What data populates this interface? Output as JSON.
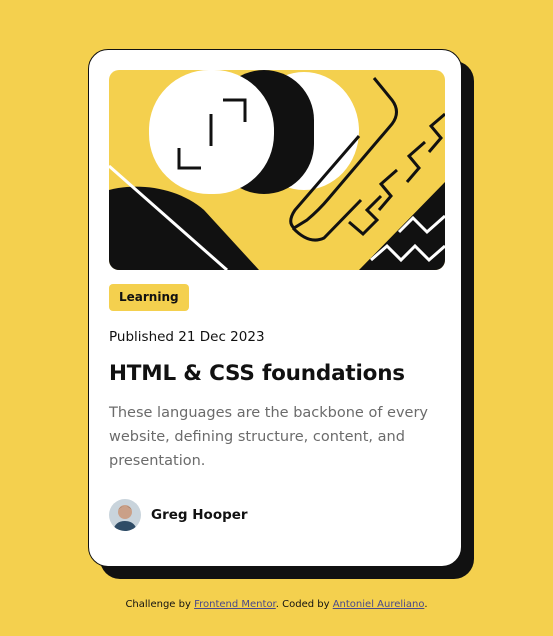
{
  "card": {
    "tag_label": "Learning",
    "published": "Published 21 Dec 2023",
    "title": "HTML & CSS foundations",
    "description": "These languages are the backbone of every website, defining structure, content, and presentation.",
    "author_name": "Greg Hooper"
  },
  "attribution": {
    "prefix": "Challenge by",
    "link1_text": "Frontend Mentor",
    "middle": ". Coded by",
    "link2_text": "Antoniel Aureliano",
    "suffix": "."
  },
  "colors": {
    "background": "#F4D04E",
    "card": "#FFFFFF",
    "ink": "#111111",
    "muted_text": "#6B6B6B"
  },
  "icons": {
    "hero": "abstract-illustration",
    "avatar": "author-avatar"
  }
}
